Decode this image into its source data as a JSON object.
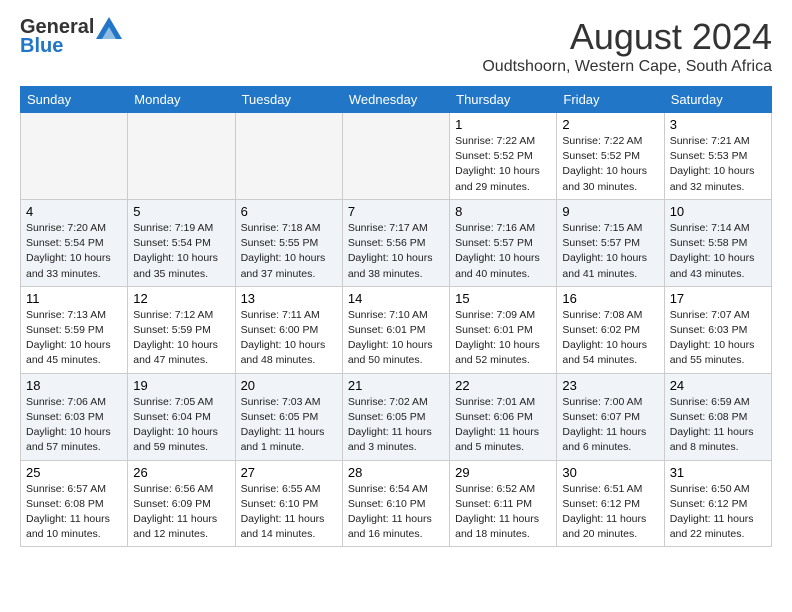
{
  "header": {
    "logo_general": "General",
    "logo_blue": "Blue",
    "month_title": "August 2024",
    "subtitle": "Oudtshoorn, Western Cape, South Africa"
  },
  "calendar": {
    "days_of_week": [
      "Sunday",
      "Monday",
      "Tuesday",
      "Wednesday",
      "Thursday",
      "Friday",
      "Saturday"
    ],
    "weeks": [
      [
        {
          "date": "",
          "detail": ""
        },
        {
          "date": "",
          "detail": ""
        },
        {
          "date": "",
          "detail": ""
        },
        {
          "date": "",
          "detail": ""
        },
        {
          "date": "1",
          "detail": "Sunrise: 7:22 AM\nSunset: 5:52 PM\nDaylight: 10 hours\nand 29 minutes."
        },
        {
          "date": "2",
          "detail": "Sunrise: 7:22 AM\nSunset: 5:52 PM\nDaylight: 10 hours\nand 30 minutes."
        },
        {
          "date": "3",
          "detail": "Sunrise: 7:21 AM\nSunset: 5:53 PM\nDaylight: 10 hours\nand 32 minutes."
        }
      ],
      [
        {
          "date": "4",
          "detail": "Sunrise: 7:20 AM\nSunset: 5:54 PM\nDaylight: 10 hours\nand 33 minutes."
        },
        {
          "date": "5",
          "detail": "Sunrise: 7:19 AM\nSunset: 5:54 PM\nDaylight: 10 hours\nand 35 minutes."
        },
        {
          "date": "6",
          "detail": "Sunrise: 7:18 AM\nSunset: 5:55 PM\nDaylight: 10 hours\nand 37 minutes."
        },
        {
          "date": "7",
          "detail": "Sunrise: 7:17 AM\nSunset: 5:56 PM\nDaylight: 10 hours\nand 38 minutes."
        },
        {
          "date": "8",
          "detail": "Sunrise: 7:16 AM\nSunset: 5:57 PM\nDaylight: 10 hours\nand 40 minutes."
        },
        {
          "date": "9",
          "detail": "Sunrise: 7:15 AM\nSunset: 5:57 PM\nDaylight: 10 hours\nand 41 minutes."
        },
        {
          "date": "10",
          "detail": "Sunrise: 7:14 AM\nSunset: 5:58 PM\nDaylight: 10 hours\nand 43 minutes."
        }
      ],
      [
        {
          "date": "11",
          "detail": "Sunrise: 7:13 AM\nSunset: 5:59 PM\nDaylight: 10 hours\nand 45 minutes."
        },
        {
          "date": "12",
          "detail": "Sunrise: 7:12 AM\nSunset: 5:59 PM\nDaylight: 10 hours\nand 47 minutes."
        },
        {
          "date": "13",
          "detail": "Sunrise: 7:11 AM\nSunset: 6:00 PM\nDaylight: 10 hours\nand 48 minutes."
        },
        {
          "date": "14",
          "detail": "Sunrise: 7:10 AM\nSunset: 6:01 PM\nDaylight: 10 hours\nand 50 minutes."
        },
        {
          "date": "15",
          "detail": "Sunrise: 7:09 AM\nSunset: 6:01 PM\nDaylight: 10 hours\nand 52 minutes."
        },
        {
          "date": "16",
          "detail": "Sunrise: 7:08 AM\nSunset: 6:02 PM\nDaylight: 10 hours\nand 54 minutes."
        },
        {
          "date": "17",
          "detail": "Sunrise: 7:07 AM\nSunset: 6:03 PM\nDaylight: 10 hours\nand 55 minutes."
        }
      ],
      [
        {
          "date": "18",
          "detail": "Sunrise: 7:06 AM\nSunset: 6:03 PM\nDaylight: 10 hours\nand 57 minutes."
        },
        {
          "date": "19",
          "detail": "Sunrise: 7:05 AM\nSunset: 6:04 PM\nDaylight: 10 hours\nand 59 minutes."
        },
        {
          "date": "20",
          "detail": "Sunrise: 7:03 AM\nSunset: 6:05 PM\nDaylight: 11 hours\nand 1 minute."
        },
        {
          "date": "21",
          "detail": "Sunrise: 7:02 AM\nSunset: 6:05 PM\nDaylight: 11 hours\nand 3 minutes."
        },
        {
          "date": "22",
          "detail": "Sunrise: 7:01 AM\nSunset: 6:06 PM\nDaylight: 11 hours\nand 5 minutes."
        },
        {
          "date": "23",
          "detail": "Sunrise: 7:00 AM\nSunset: 6:07 PM\nDaylight: 11 hours\nand 6 minutes."
        },
        {
          "date": "24",
          "detail": "Sunrise: 6:59 AM\nSunset: 6:08 PM\nDaylight: 11 hours\nand 8 minutes."
        }
      ],
      [
        {
          "date": "25",
          "detail": "Sunrise: 6:57 AM\nSunset: 6:08 PM\nDaylight: 11 hours\nand 10 minutes."
        },
        {
          "date": "26",
          "detail": "Sunrise: 6:56 AM\nSunset: 6:09 PM\nDaylight: 11 hours\nand 12 minutes."
        },
        {
          "date": "27",
          "detail": "Sunrise: 6:55 AM\nSunset: 6:10 PM\nDaylight: 11 hours\nand 14 minutes."
        },
        {
          "date": "28",
          "detail": "Sunrise: 6:54 AM\nSunset: 6:10 PM\nDaylight: 11 hours\nand 16 minutes."
        },
        {
          "date": "29",
          "detail": "Sunrise: 6:52 AM\nSunset: 6:11 PM\nDaylight: 11 hours\nand 18 minutes."
        },
        {
          "date": "30",
          "detail": "Sunrise: 6:51 AM\nSunset: 6:12 PM\nDaylight: 11 hours\nand 20 minutes."
        },
        {
          "date": "31",
          "detail": "Sunrise: 6:50 AM\nSunset: 6:12 PM\nDaylight: 11 hours\nand 22 minutes."
        }
      ]
    ]
  }
}
